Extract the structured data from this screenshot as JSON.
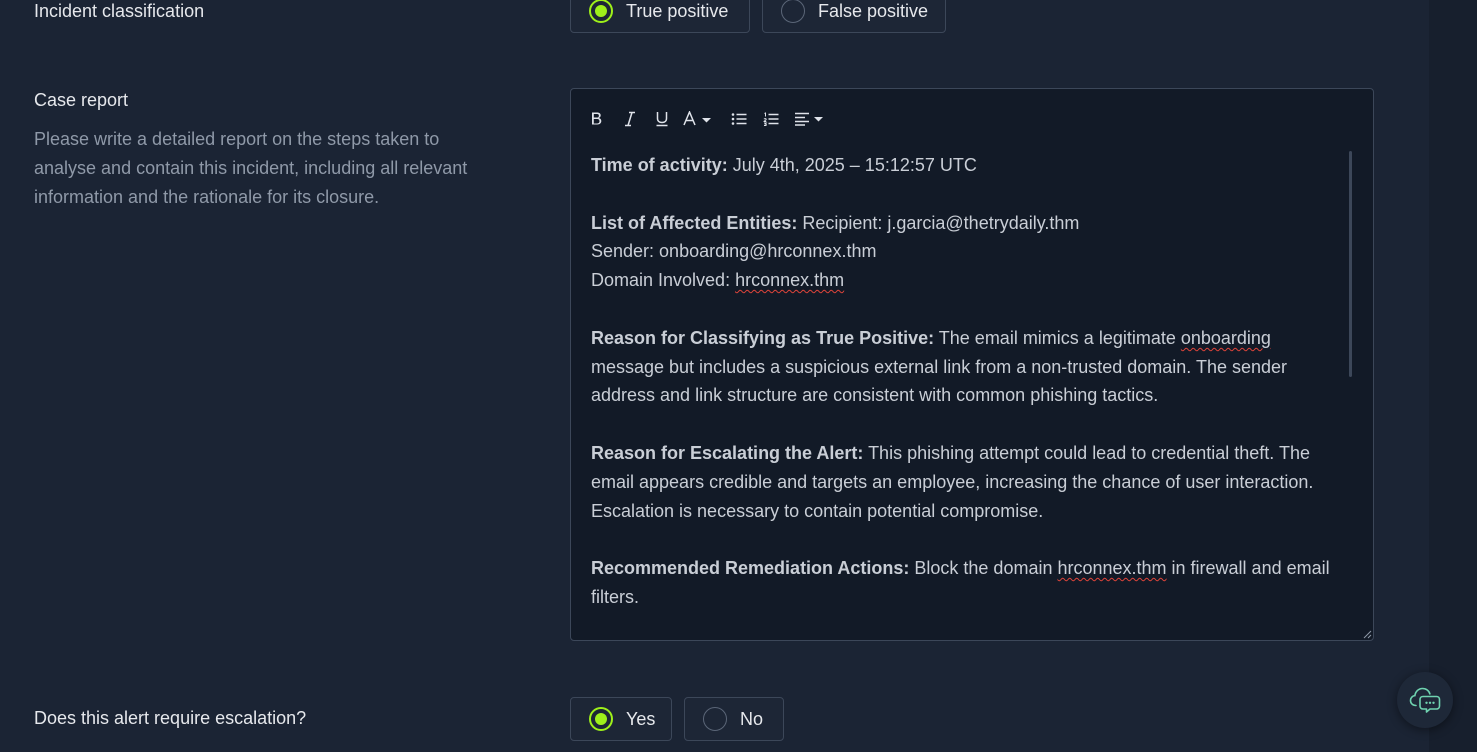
{
  "classification": {
    "label": "Incident classification",
    "options": [
      {
        "label": "True positive",
        "checked": true
      },
      {
        "label": "False positive",
        "checked": false
      }
    ]
  },
  "case_report": {
    "label": "Case report",
    "help": "Please write a detailed report on the steps taken to analyse and contain this incident, including all relevant information and the rationale for its closure.",
    "toolbar": [
      "bold-icon",
      "italic-icon",
      "underline-icon",
      "font-color-icon",
      "bullet-list-icon",
      "numbered-list-icon",
      "align-icon"
    ],
    "content": {
      "time_label": "Time of activity:",
      "time_value": " July 4th, 2025 – 15:12:57 UTC",
      "entities_label": "List of Affected Entities:",
      "entities_recipient": " Recipient: j.garcia@thetrydaily.thm",
      "entities_sender": "Sender: onboarding@hrconnex.thm",
      "domain_prefix": "Domain Involved: ",
      "domain_value": "hrconnex.thm",
      "reason_label": "Reason for Classifying as True Positive:",
      "reason_pre": " The email mimics a legitimate ",
      "reason_word": "onboarding",
      "reason_post": " message but includes a suspicious external link from a non-trusted domain. The sender address and link structure are consistent with common phishing tactics.",
      "escalate_label": "Reason for Escalating the Alert:",
      "escalate_text": " This phishing attempt could lead to credential theft. The email appears credible and targets an employee, increasing the chance of user interaction. Escalation is necessary to contain potential compromise.",
      "remediation_label": "Recommended Remediation Actions:",
      "remediation_pre": " Block the domain ",
      "remediation_domain": "hrconnex.thm",
      "remediation_post": " in firewall and email filters."
    }
  },
  "escalation": {
    "label": "Does this alert require escalation?",
    "options": [
      {
        "label": "Yes",
        "checked": true
      },
      {
        "label": "No",
        "checked": false
      }
    ]
  },
  "colors": {
    "accent": "#9ef01a",
    "background": "#1b2434",
    "editor_bg": "#121a27",
    "spellcheck": "#e0443a"
  },
  "chat_button": {
    "icon": "chat-cloud-icon"
  }
}
